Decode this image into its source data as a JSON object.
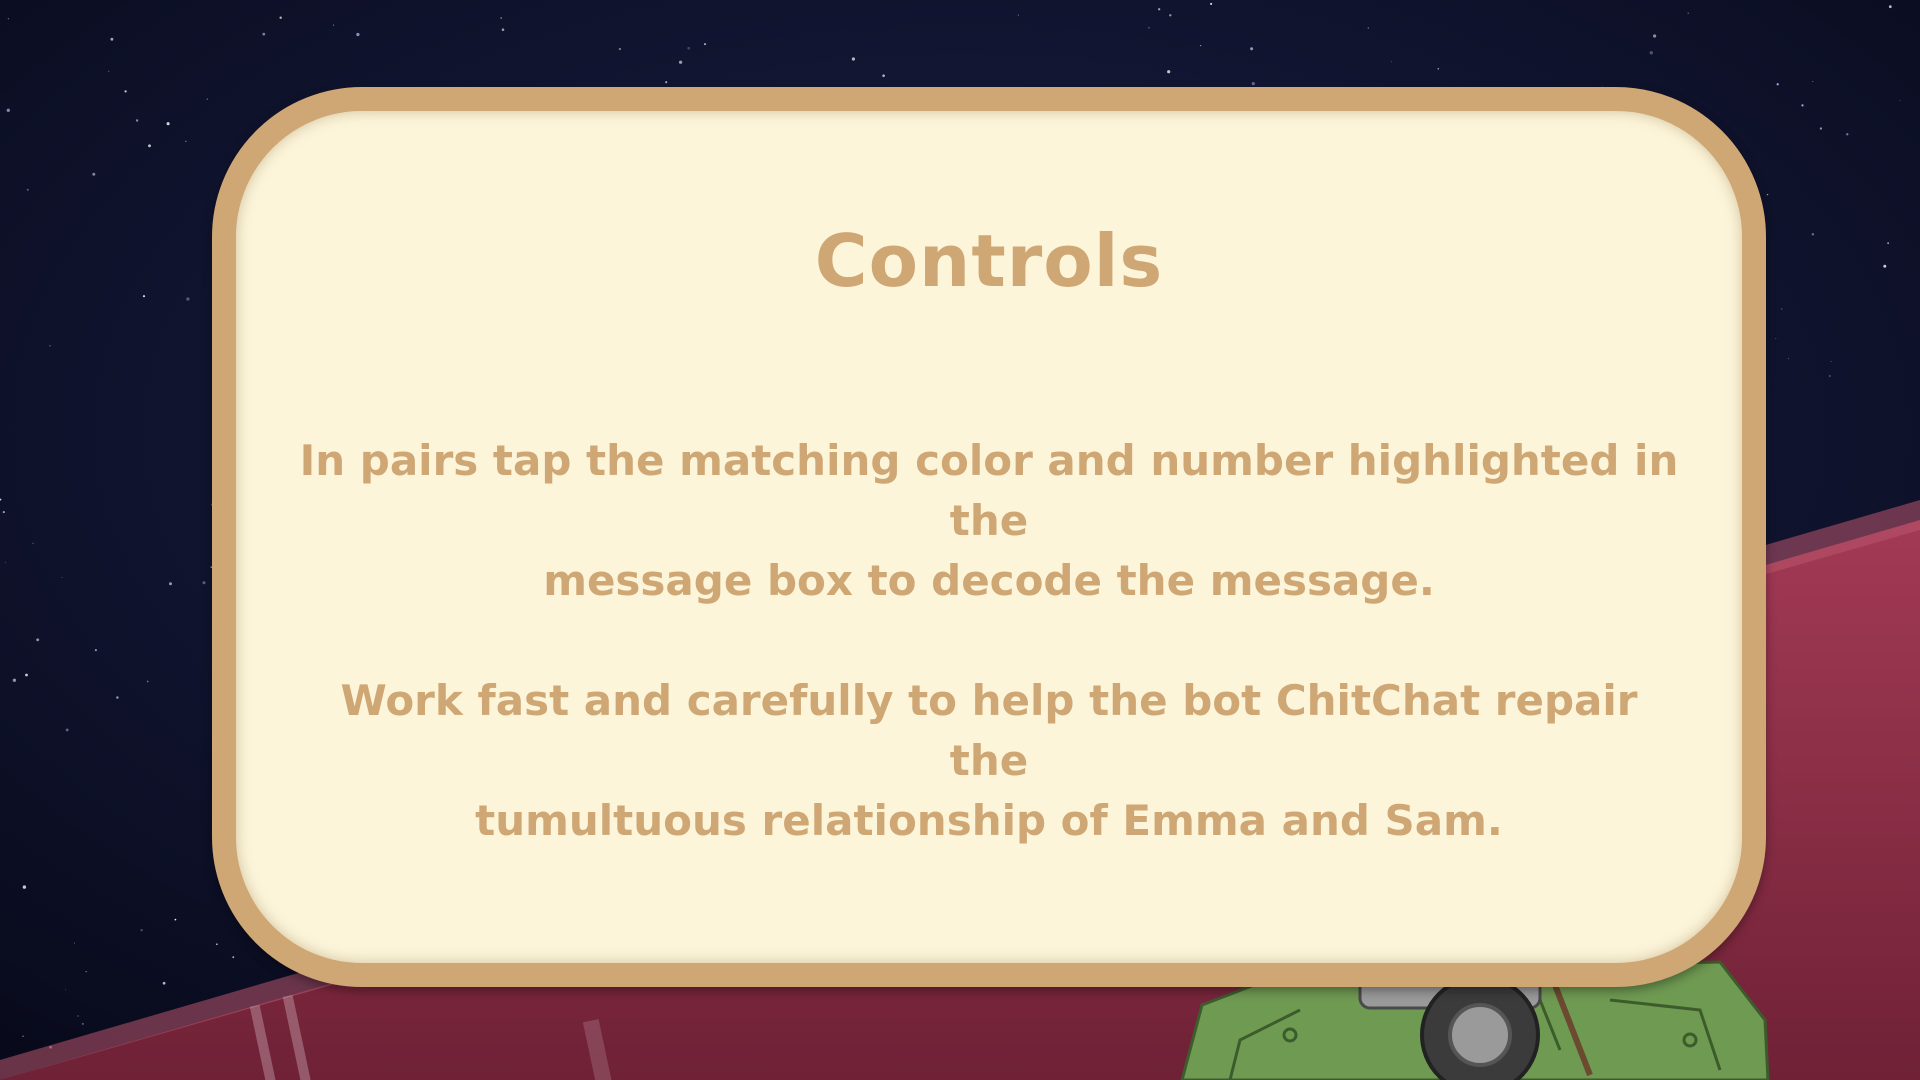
{
  "dialog": {
    "title": "Controls",
    "paragraphs": [
      "In pairs tap the matching color and number highlighted in the\nmessage box to decode the message.",
      "Work fast and carefully to help the bot ChitChat repair the\ntumultuous relationship of Emma and Sam."
    ]
  },
  "background": {
    "sky": "starfield",
    "ground": "red planet surface",
    "robot": "robot-wheel-icon"
  },
  "colors": {
    "panel_fill": "#fcf5da",
    "panel_border": "#cfa775",
    "text": "#cfa775",
    "sky": "#0d1029",
    "ground": "#8e2f48",
    "robot_body": "#6f9a52"
  }
}
